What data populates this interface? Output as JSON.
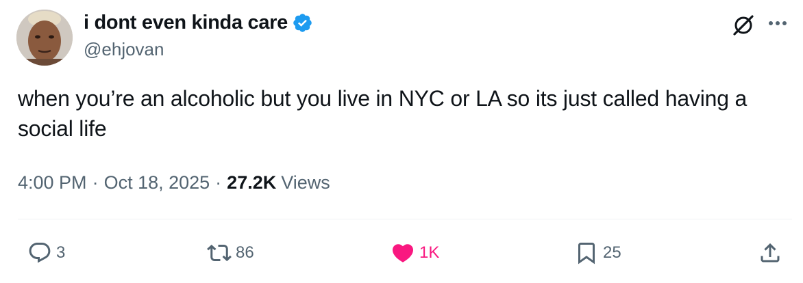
{
  "author": {
    "display_name": "i dont even kinda care",
    "handle": "@ehjovan",
    "verified": true
  },
  "tweet": {
    "text": "when you’re an alcoholic but you live in NYC or LA so its just called having a social life"
  },
  "meta": {
    "time": "4:00 PM",
    "separator": "·",
    "date": "Oct 18, 2025",
    "views_count": "27.2K",
    "views_label": "Views"
  },
  "actions": {
    "replies": "3",
    "reposts": "86",
    "likes": "1K",
    "bookmarks": "25"
  },
  "colors": {
    "verified_blue": "#1d9bf0",
    "like_pink": "#f91880",
    "secondary_text": "#536471",
    "primary_text": "#0f1419"
  }
}
